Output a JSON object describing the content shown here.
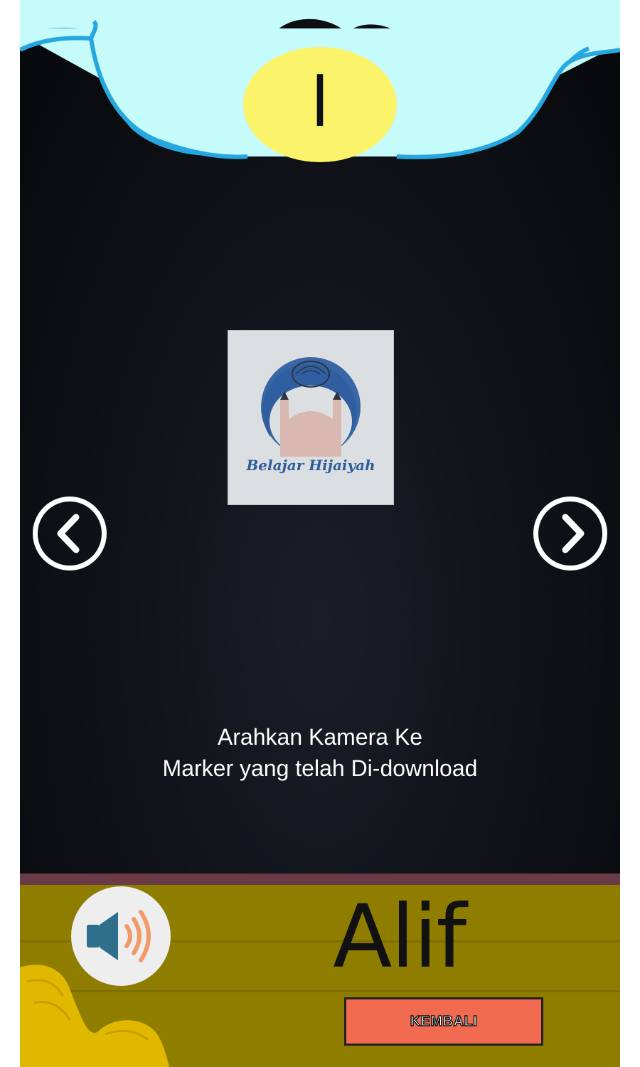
{
  "header": {
    "hijaiyah_letter": "ا"
  },
  "marker": {
    "caption": "Belajar Hijaiyah",
    "icon": "mosque-icon"
  },
  "navigation": {
    "prev_icon": "chevron-left-icon",
    "next_icon": "chevron-right-icon"
  },
  "instruction": {
    "line1": "Arahkan Kamera Ke",
    "line2": "Marker yang telah Di-download"
  },
  "footer": {
    "sound_icon": "speaker-icon",
    "letter_name": "Alif",
    "back_label": "KEMBALI"
  },
  "colors": {
    "sky": "#c6fbfb",
    "cloud_outline": "#27a7e0",
    "badge": "#fbf36a",
    "ground": "#8f7d00",
    "back_button": "#f06b50"
  }
}
